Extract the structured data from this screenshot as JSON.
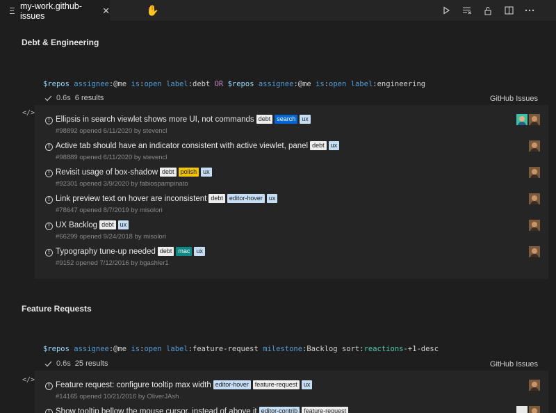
{
  "tab": {
    "label": "my-work.github-issues",
    "close": "✕"
  },
  "sections": [
    {
      "title": "Debt & Engineering",
      "query": [
        {
          "t": "$repos",
          "c": "q-var"
        },
        {
          "t": " ",
          "c": ""
        },
        {
          "t": "assignee",
          "c": "q-key"
        },
        {
          "t": ":@me ",
          "c": "q-val"
        },
        {
          "t": "is",
          "c": "q-key"
        },
        {
          "t": ":",
          "c": "q-val"
        },
        {
          "t": "open",
          "c": "q-key"
        },
        {
          "t": " ",
          "c": ""
        },
        {
          "t": "label",
          "c": "q-key"
        },
        {
          "t": ":debt ",
          "c": "q-val"
        },
        {
          "t": "OR",
          "c": "q-or"
        },
        {
          "t": " ",
          "c": ""
        },
        {
          "t": "$repos",
          "c": "q-var"
        },
        {
          "t": " ",
          "c": ""
        },
        {
          "t": "assignee",
          "c": "q-key"
        },
        {
          "t": ":@me ",
          "c": "q-val"
        },
        {
          "t": "is",
          "c": "q-key"
        },
        {
          "t": ":",
          "c": "q-val"
        },
        {
          "t": "open",
          "c": "q-key"
        },
        {
          "t": " ",
          "c": ""
        },
        {
          "t": "label",
          "c": "q-key"
        },
        {
          "t": ":engineering",
          "c": "q-val"
        }
      ],
      "duration": "0.6s",
      "results": "6 results",
      "renderer": "GitHub Issues",
      "code_icon": "</>",
      "issues": [
        {
          "title": "Ellipsis in search viewlet shows more UI, not commands",
          "labels": [
            "debt",
            "search",
            "ux"
          ],
          "meta": "#98892 opened 6/11/2020 by stevencl",
          "avatars": [
            "g",
            "b"
          ]
        },
        {
          "title": "Active tab should have an indicator consistent with active viewlet, panel",
          "labels": [
            "debt",
            "ux"
          ],
          "meta": "#98889 opened 6/11/2020 by stevencl",
          "avatars": [
            "b"
          ]
        },
        {
          "title": "Revisit usage of box-shadow",
          "labels": [
            "debt",
            "polish",
            "ux"
          ],
          "meta": "#92301 opened 3/9/2020 by fabiospampinato",
          "avatars": [
            "b"
          ]
        },
        {
          "title": "Link preview text on hover are inconsistent",
          "labels": [
            "debt",
            "editor-hover",
            "ux"
          ],
          "meta": "#78647 opened 8/7/2019 by misolori",
          "avatars": [
            "b"
          ]
        },
        {
          "title": "UX Backlog",
          "labels": [
            "debt",
            "ux"
          ],
          "meta": "#66299 opened 9/24/2018 by misolori",
          "avatars": [
            "b"
          ]
        },
        {
          "title": "Typography tune-up needed",
          "labels": [
            "debt",
            "mac",
            "ux"
          ],
          "meta": "#9152 opened 7/12/2016 by bgashler1",
          "avatars": [
            "b"
          ]
        }
      ]
    },
    {
      "title": "Feature Requests",
      "query": [
        {
          "t": "$repos",
          "c": "q-var"
        },
        {
          "t": " ",
          "c": ""
        },
        {
          "t": "assignee",
          "c": "q-key"
        },
        {
          "t": ":@me ",
          "c": "q-val"
        },
        {
          "t": "is",
          "c": "q-key"
        },
        {
          "t": ":",
          "c": "q-val"
        },
        {
          "t": "open",
          "c": "q-key"
        },
        {
          "t": " ",
          "c": ""
        },
        {
          "t": "label",
          "c": "q-key"
        },
        {
          "t": ":feature-request ",
          "c": "q-val"
        },
        {
          "t": "milestone",
          "c": "q-key"
        },
        {
          "t": ":Backlog ",
          "c": "q-val"
        },
        {
          "t": "sort",
          "c": "q-val"
        },
        {
          "t": ":",
          "c": "q-val"
        },
        {
          "t": "reactions",
          "c": "q-sort"
        },
        {
          "t": "-+1-desc",
          "c": "q-val"
        }
      ],
      "duration": "0.6s",
      "results": "25 results",
      "renderer": "GitHub Issues",
      "code_icon": "</>",
      "issues": [
        {
          "title": "Feature request: configure tooltip max width",
          "labels": [
            "editor-hover",
            "feature-request",
            "ux"
          ],
          "meta": "#14165 opened 10/21/2016 by OliverJAsh",
          "avatars": [
            "b"
          ]
        },
        {
          "title": "Show tooltip bellow the mouse cursor, instead of above it",
          "labels": [
            "editor-contrib",
            "feature-request"
          ],
          "meta": "",
          "avatars": [
            "w",
            "b"
          ]
        }
      ]
    }
  ],
  "label_colors": {
    "debt": {
      "bg": "#ededed",
      "fg": "#1e1e1e"
    },
    "search": {
      "bg": "#0066d6",
      "fg": "#ffffff"
    },
    "ux": {
      "bg": "#c5def5",
      "fg": "#1e1e1e"
    },
    "polish": {
      "bg": "#f3c30b",
      "fg": "#1e1e1e"
    },
    "editor-hover": {
      "bg": "#c5def5",
      "fg": "#1e1e1e"
    },
    "mac": {
      "bg": "#0e8a86",
      "fg": "#ffffff"
    },
    "feature-request": {
      "bg": "#ededed",
      "fg": "#1e1e1e"
    },
    "editor-contrib": {
      "bg": "#c5def5",
      "fg": "#1e1e1e"
    }
  },
  "icons": {
    "file": "file-lines-icon",
    "hand": "hand-cursor-icon",
    "run": "run-icon",
    "clear": "clear-outputs-icon",
    "lock": "lock-icon",
    "split": "split-editor-icon",
    "more": "more-actions-icon",
    "check": "check-icon",
    "issue": "issue-open-icon"
  }
}
